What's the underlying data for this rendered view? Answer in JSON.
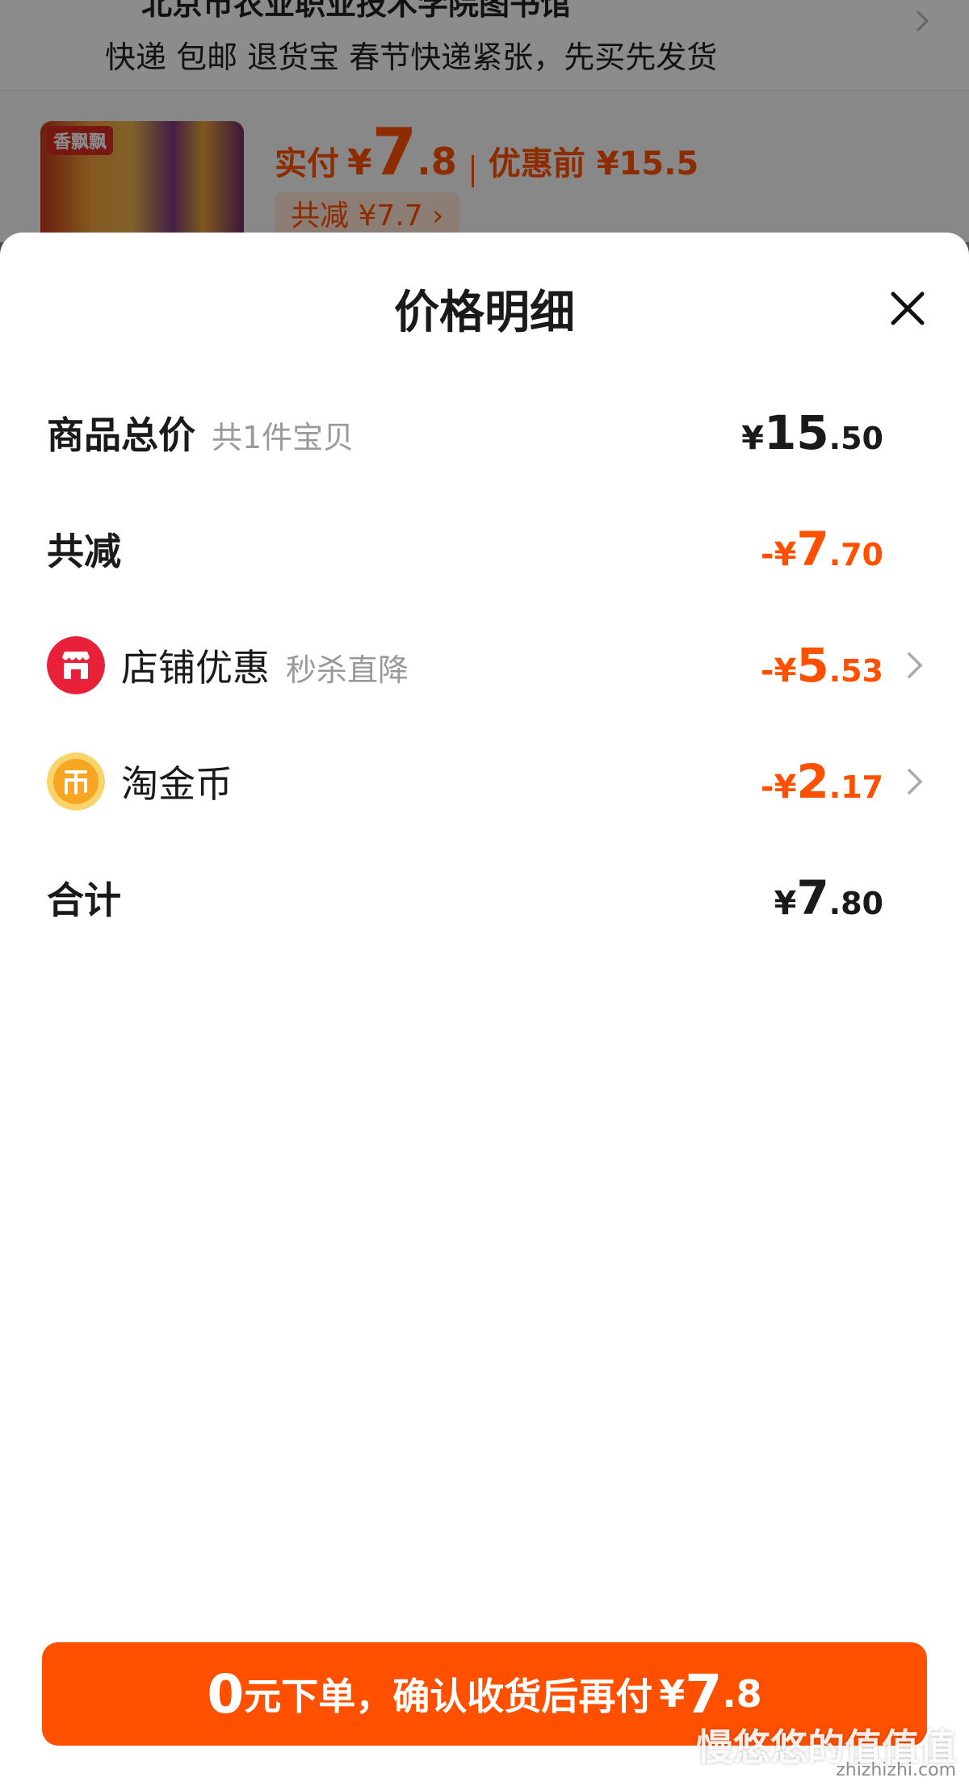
{
  "background": {
    "address": "北京市农业职业技术学院图书馆",
    "delivery": "快递 包邮 退货宝 春节快递紧张，先买先发货",
    "product_brand": "香飘飘",
    "price_label": "实付",
    "price_yen": "¥",
    "price_int": "7",
    "price_dec": ".8",
    "original_price": "优惠前 ¥15.5",
    "reduce_chip": "共减 ¥7.7 ›"
  },
  "sheet": {
    "title": "价格明细",
    "rows": [
      {
        "label": "商品总价",
        "sublabel": "共1件宝贝",
        "yen": "¥",
        "int": "15",
        "dec": ".50"
      },
      {
        "label": "共减",
        "yen": "-¥",
        "int": "7",
        "dec": ".70"
      },
      {
        "label": "店铺优惠",
        "sublabel": "秒杀直降",
        "yen": "-¥",
        "int": "5",
        "dec": ".53",
        "icon": "shop-icon"
      },
      {
        "label": "淘金币",
        "yen": "-¥",
        "int": "2",
        "dec": ".17",
        "icon": "coin-icon"
      },
      {
        "label": "合计",
        "yen": "¥",
        "int": "7",
        "dec": ".80"
      }
    ]
  },
  "cta": {
    "zero": "0",
    "text": "元下单，确认收货后再付",
    "yen": "¥",
    "int": "7",
    "dec": ".8"
  },
  "watermark": {
    "text": "慢悠悠的值值值",
    "site": "zhizhizhi.com"
  },
  "colors": {
    "accent": "#ff5000",
    "shop_icon": "#e8203a",
    "coin_icon": "#f6a623",
    "text": "#1a1a1a",
    "muted": "#999999"
  }
}
